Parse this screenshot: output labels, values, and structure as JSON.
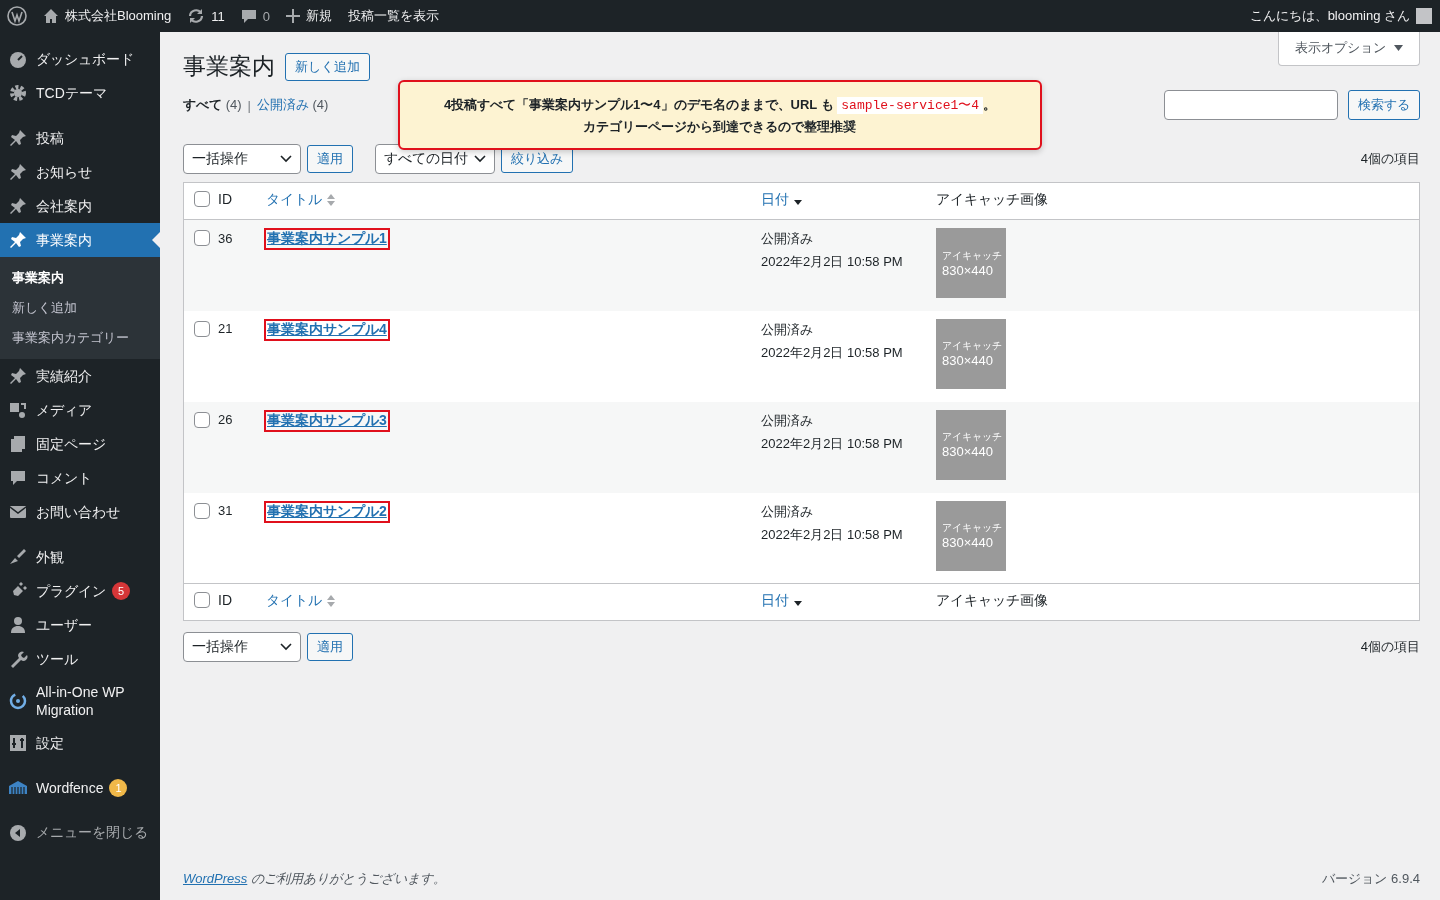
{
  "admin_bar": {
    "site_name": "株式会社Blooming",
    "updates": "11",
    "comments": "0",
    "new": "新規",
    "view_posts": "投稿一覧を表示",
    "greeting": "こんにちは、blooming さん"
  },
  "sidebar": {
    "menu_groups": [
      [
        {
          "label": "ダッシュボード",
          "selected": false
        },
        {
          "label": "TCDテーマ",
          "selected": false
        }
      ],
      [
        {
          "label": "投稿",
          "selected": false
        },
        {
          "label": "お知らせ",
          "selected": false
        },
        {
          "label": "会社案内",
          "selected": false
        },
        {
          "label": "事業案内",
          "selected": true,
          "submenu": [
            {
              "label": "事業案内",
              "selected": true
            },
            {
              "label": "新しく追加",
              "selected": false
            },
            {
              "label": "事業案内カテゴリー",
              "selected": false
            }
          ]
        },
        {
          "label": "実績紹介",
          "selected": false
        },
        {
          "label": "メディア",
          "selected": false
        },
        {
          "label": "固定ページ",
          "selected": false
        },
        {
          "label": "コメント",
          "selected": false
        },
        {
          "label": "お問い合わせ",
          "selected": false
        }
      ],
      [
        {
          "label": "外観",
          "selected": false
        },
        {
          "label": "プラグイン",
          "selected": false,
          "badge": "5",
          "color": "#d63638"
        },
        {
          "label": "ユーザー",
          "selected": false
        },
        {
          "label": "ツール",
          "selected": false
        },
        {
          "label": "All-in-One WP Migration",
          "selected": false
        },
        {
          "label": "設定",
          "selected": false
        }
      ],
      [
        {
          "label": "Wordfence",
          "selected": false,
          "badge": "1",
          "color": "#f0b849"
        }
      ]
    ],
    "collapse_menu": "メニューを閉じる"
  },
  "page": {
    "title": "事業案内",
    "add_new": "新しく追加",
    "screen_options": "表示オプション",
    "views_separator": "|",
    "views": [
      {
        "label": "すべて",
        "count": "(4)",
        "selected": true
      },
      {
        "label": "公開済み",
        "count": "(4)",
        "selected": false
      }
    ],
    "search_button": "検索する",
    "bulk_action": "一括操作",
    "apply": "適用",
    "date_filter": "すべての日付",
    "filter": "絞り込み",
    "item_count": "4個の項目",
    "bottom_bulk_action": "一括操作",
    "bottom_apply": "適用",
    "bottom_item_count": "4個の項目"
  },
  "callout": {
    "text_before": "4投稿すべて「事業案内サンプル1〜4」のデモ名のままで、URL も",
    "code": "sample-service1〜4",
    "text_after": "。",
    "line_2": "カテゴリーページから到達できるので整理推奨"
  },
  "table": {
    "select_all_checked": false,
    "footer_select_all_checked": false,
    "columns": [
      {
        "label": "ID",
        "kind": "plain"
      },
      {
        "label": "タイトル",
        "kind": "sortable"
      },
      {
        "label": "日付",
        "kind": "sorted"
      },
      {
        "label": "アイキャッチ画像",
        "kind": "plain"
      }
    ],
    "footer_columns": [
      {
        "label": "ID",
        "kind": "plain"
      },
      {
        "label": "タイトル",
        "kind": "sortable"
      },
      {
        "label": "日付",
        "kind": "sorted"
      },
      {
        "label": "アイキャッチ画像",
        "kind": "plain"
      }
    ],
    "rows": [
      {
        "id": "36",
        "title": "事業案内サンプル1",
        "highlighted": true,
        "checked": false,
        "status": "公開済み",
        "date": "2022年2月2日 10:58 PM",
        "thumb_label": "アイキャッチ",
        "thumb_size": "830×440"
      },
      {
        "id": "21",
        "title": "事業案内サンプル4",
        "highlighted": true,
        "checked": false,
        "status": "公開済み",
        "date": "2022年2月2日 10:58 PM",
        "thumb_label": "アイキャッチ",
        "thumb_size": "830×440"
      },
      {
        "id": "26",
        "title": "事業案内サンプル3",
        "highlighted": true,
        "checked": false,
        "status": "公開済み",
        "date": "2022年2月2日 10:58 PM",
        "thumb_label": "アイキャッチ",
        "thumb_size": "830×440"
      },
      {
        "id": "31",
        "title": "事業案内サンプル2",
        "highlighted": true,
        "checked": false,
        "status": "公開済み",
        "date": "2022年2月2日 10:58 PM",
        "thumb_label": "アイキャッチ",
        "thumb_size": "830×440"
      }
    ]
  },
  "footer": {
    "link": "WordPress",
    "text": "のご利用ありがとうございます。",
    "version": "バージョン 6.9.4"
  }
}
